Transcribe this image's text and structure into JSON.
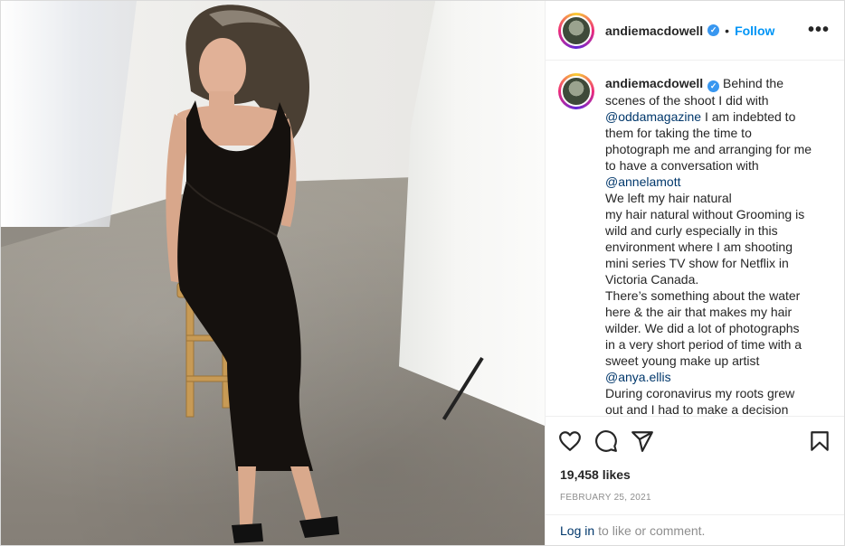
{
  "author": {
    "username": "andiemacdowell",
    "follow_label": "Follow",
    "separator": "•",
    "more_label": "•••"
  },
  "caption": {
    "username": "andiemacdowell",
    "lines": [
      "Behind the",
      "scenes of the shoot I did with",
      "@oddamagazine",
      " I am indebted to",
      "them for taking the time to",
      "photograph me and arranging for me",
      "to have a conversation with",
      "@annelamott",
      "We left my hair natural",
      "my hair natural without Grooming is",
      "wild and curly especially in this",
      "environment where I am shooting",
      "mini series TV show for Netflix in",
      "Victoria Canada.",
      "There’s something about the water",
      "here & the air that makes my hair",
      "wilder. We did a lot of photographs",
      "in a very short period of time with a",
      "sweet young make up artist",
      "@anya.ellis",
      "During coronavirus my roots grew",
      "out and I had to make a decision"
    ]
  },
  "actions": {
    "like_icon": "heart-icon",
    "comment_icon": "comment-icon",
    "share_icon": "share-icon",
    "save_icon": "bookmark-icon"
  },
  "stats": {
    "likes": "19,458 likes",
    "date": "FEBRUARY 25, 2021"
  },
  "footer": {
    "login_link": "Log in",
    "login_rest": "to like or comment."
  },
  "colors": {
    "link_blue": "#0095f6",
    "mention": "#00376b",
    "verified": "#3897f0",
    "muted": "#8e8e8e"
  }
}
